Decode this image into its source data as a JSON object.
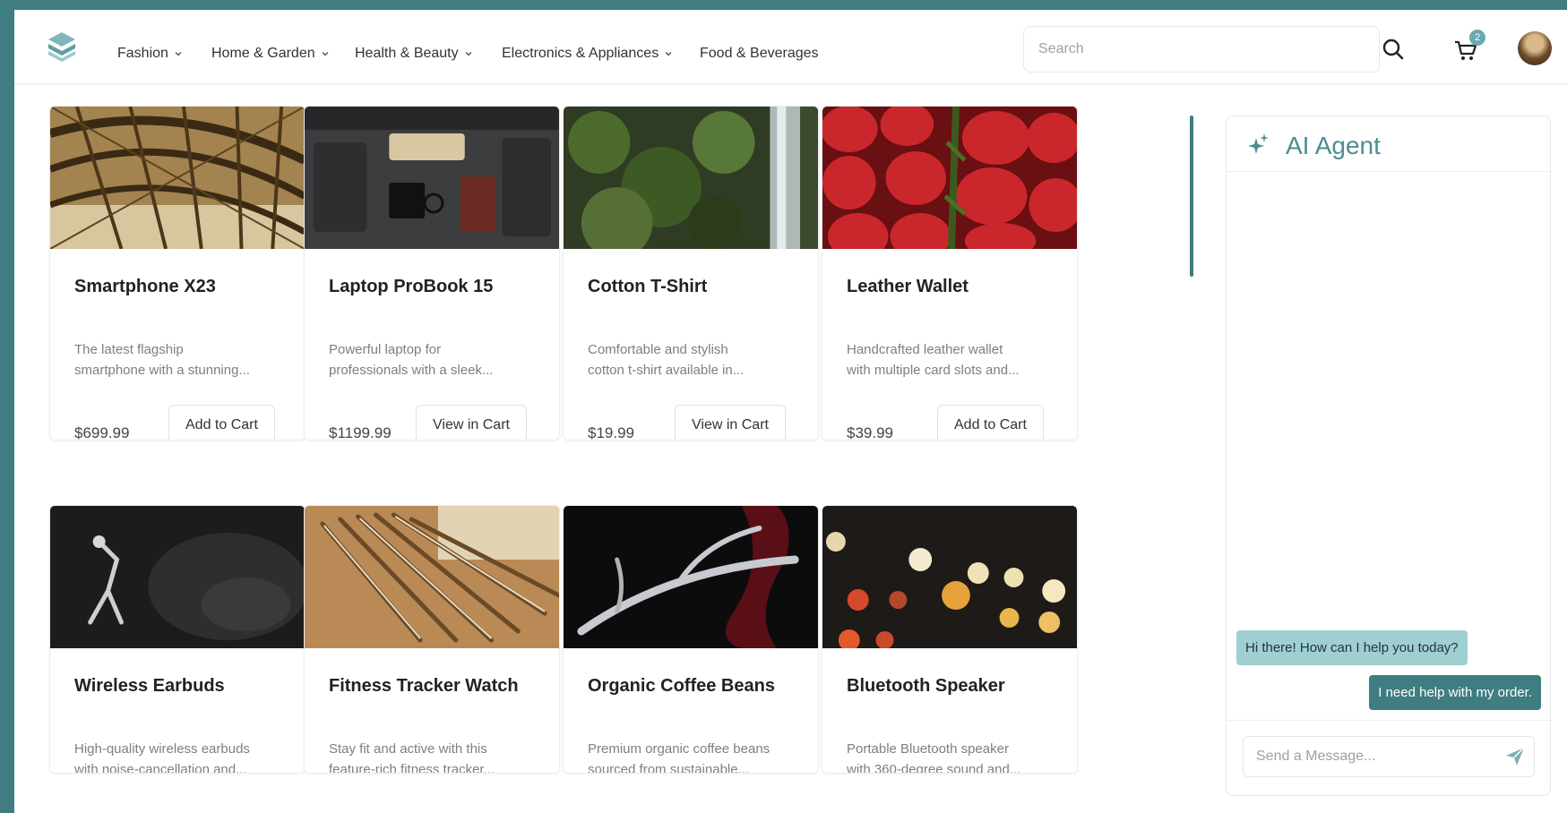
{
  "nav": {
    "items": [
      {
        "label": "Fashion",
        "has_dropdown": true
      },
      {
        "label": "Home & Garden",
        "has_dropdown": true
      },
      {
        "label": "Health & Beauty",
        "has_dropdown": true
      },
      {
        "label": "Electronics & Appliances",
        "has_dropdown": true
      },
      {
        "label": "Food & Beverages",
        "has_dropdown": false
      }
    ],
    "search_placeholder": "Search",
    "cart_count": "2",
    "icons": {
      "logo": "stack-logo-icon",
      "search": "search-icon",
      "cart": "cart-icon"
    }
  },
  "products": [
    {
      "title": "Smartphone X23",
      "desc_line1": "The latest flagship",
      "desc_line2": "smartphone with a stunning...",
      "price": "$699.99",
      "button": "Add to Cart"
    },
    {
      "title": "Laptop ProBook 15",
      "desc_line1": "Powerful laptop for",
      "desc_line2": "professionals with a sleek...",
      "price": "$1199.99",
      "button": "View in Cart"
    },
    {
      "title": "Cotton T-Shirt",
      "desc_line1": "Comfortable and stylish",
      "desc_line2": "cotton t-shirt available in...",
      "price": "$19.99",
      "button": "View in Cart"
    },
    {
      "title": "Leather Wallet",
      "desc_line1": "Handcrafted leather wallet",
      "desc_line2": "with multiple card slots and...",
      "price": "$39.99",
      "button": "Add to Cart"
    },
    {
      "title": "Wireless Earbuds",
      "desc_line1": "High-quality wireless earbuds",
      "desc_line2": "with noise-cancellation and..."
    },
    {
      "title": "Fitness Tracker Watch",
      "desc_line1": "Stay fit and active with this",
      "desc_line2": "feature-rich fitness tracker..."
    },
    {
      "title": "Organic Coffee Beans",
      "desc_line1": "Premium organic coffee beans",
      "desc_line2": "sourced from sustainable..."
    },
    {
      "title": "Bluetooth Speaker",
      "desc_line1": "Portable Bluetooth speaker",
      "desc_line2": "with 360-degree sound and..."
    }
  ],
  "agent": {
    "title": "AI Agent",
    "messages": [
      {
        "from": "bot",
        "text": "Hi there! How can I help you today?"
      },
      {
        "from": "user",
        "text": "I need help with my order."
      }
    ],
    "input_placeholder": "Send a Message...",
    "icons": {
      "title": "sparkle-icon",
      "send": "send-icon"
    }
  },
  "colors": {
    "accent": "#3f7d80",
    "accent_light": "#9fcfd1",
    "title_teal": "#4a8d92"
  }
}
